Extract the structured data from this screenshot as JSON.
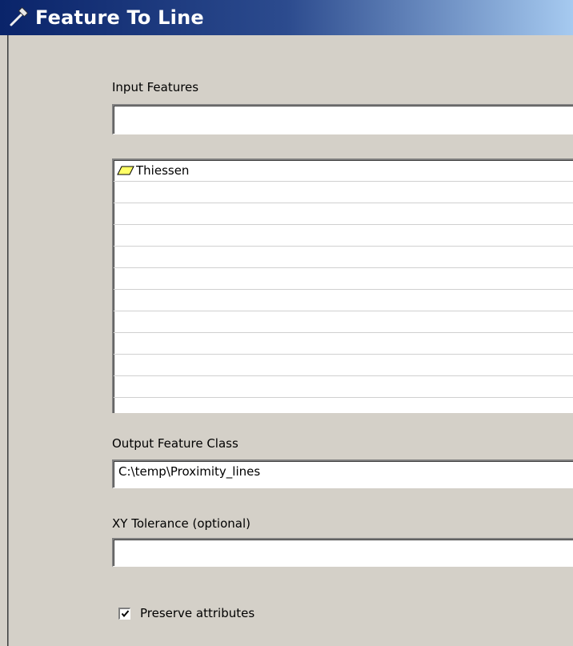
{
  "window": {
    "title": "Feature To Line",
    "title_icon": "hammer-icon"
  },
  "input_features": {
    "label": "Input Features",
    "value": "",
    "list_items": [
      {
        "label": "Thiessen",
        "icon": "polygon-layer-icon"
      }
    ]
  },
  "output_feature_class": {
    "label": "Output Feature Class",
    "value": "C:\\temp\\Proximity_lines"
  },
  "xy_tolerance": {
    "label": "XY Tolerance (optional)",
    "value": ""
  },
  "preserve_attributes": {
    "label": "Preserve attributes",
    "checked": true
  },
  "colors": {
    "title_gradient_start": "#0a246a",
    "title_gradient_end": "#a6caf0",
    "background": "#d4d0c8",
    "polygon_icon_fill": "#ffff66"
  }
}
